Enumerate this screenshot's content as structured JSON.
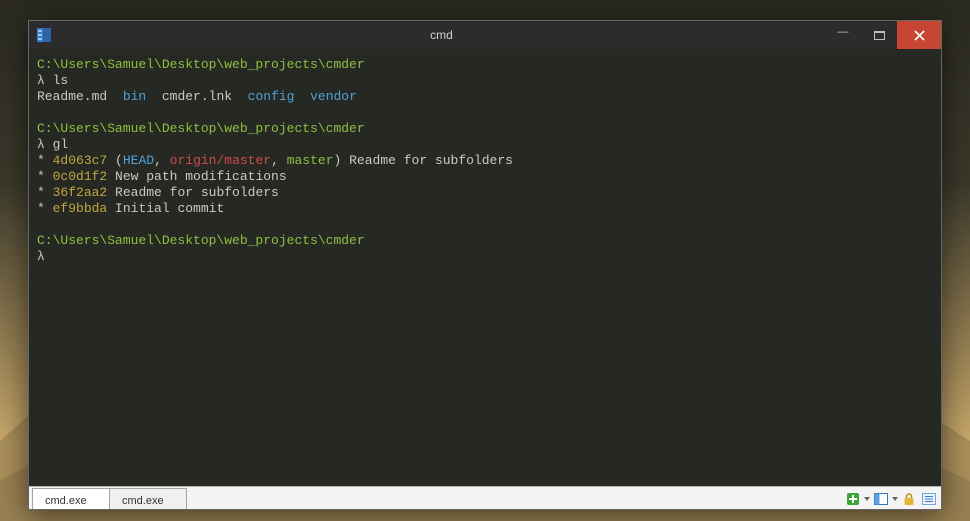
{
  "window": {
    "title": "cmd"
  },
  "terminal": {
    "prompt1_path": "C:\\Users\\Samuel\\Desktop\\web_projects\\cmder",
    "lambda": "λ",
    "cmd1": "ls",
    "ls_output": {
      "readme": "Readme.md",
      "bin": "bin",
      "lnk": "cmder.lnk",
      "config": "config",
      "vendor": "vendor"
    },
    "prompt2_path": "C:\\Users\\Samuel\\Desktop\\web_projects\\cmder",
    "cmd2": "gl",
    "log": [
      {
        "star": "*",
        "hash": "4d063c7",
        "refs_open": " (",
        "head": "HEAD",
        "sep1": ", ",
        "origin": "origin/master",
        "sep2": ", ",
        "master": "master",
        "refs_close": ") ",
        "msg": "Readme for subfolders"
      },
      {
        "star": "*",
        "hash": "0c0d1f2",
        "msg": " New path modifications"
      },
      {
        "star": "*",
        "hash": "36f2aa2",
        "msg": " Readme for subfolders"
      },
      {
        "star": "*",
        "hash": "ef9bbda",
        "msg": " Initial commit"
      }
    ],
    "prompt3_path": "C:\\Users\\Samuel\\Desktop\\web_projects\\cmder"
  },
  "tabs": [
    {
      "label": "cmd.exe"
    },
    {
      "label": "cmd.exe"
    }
  ]
}
